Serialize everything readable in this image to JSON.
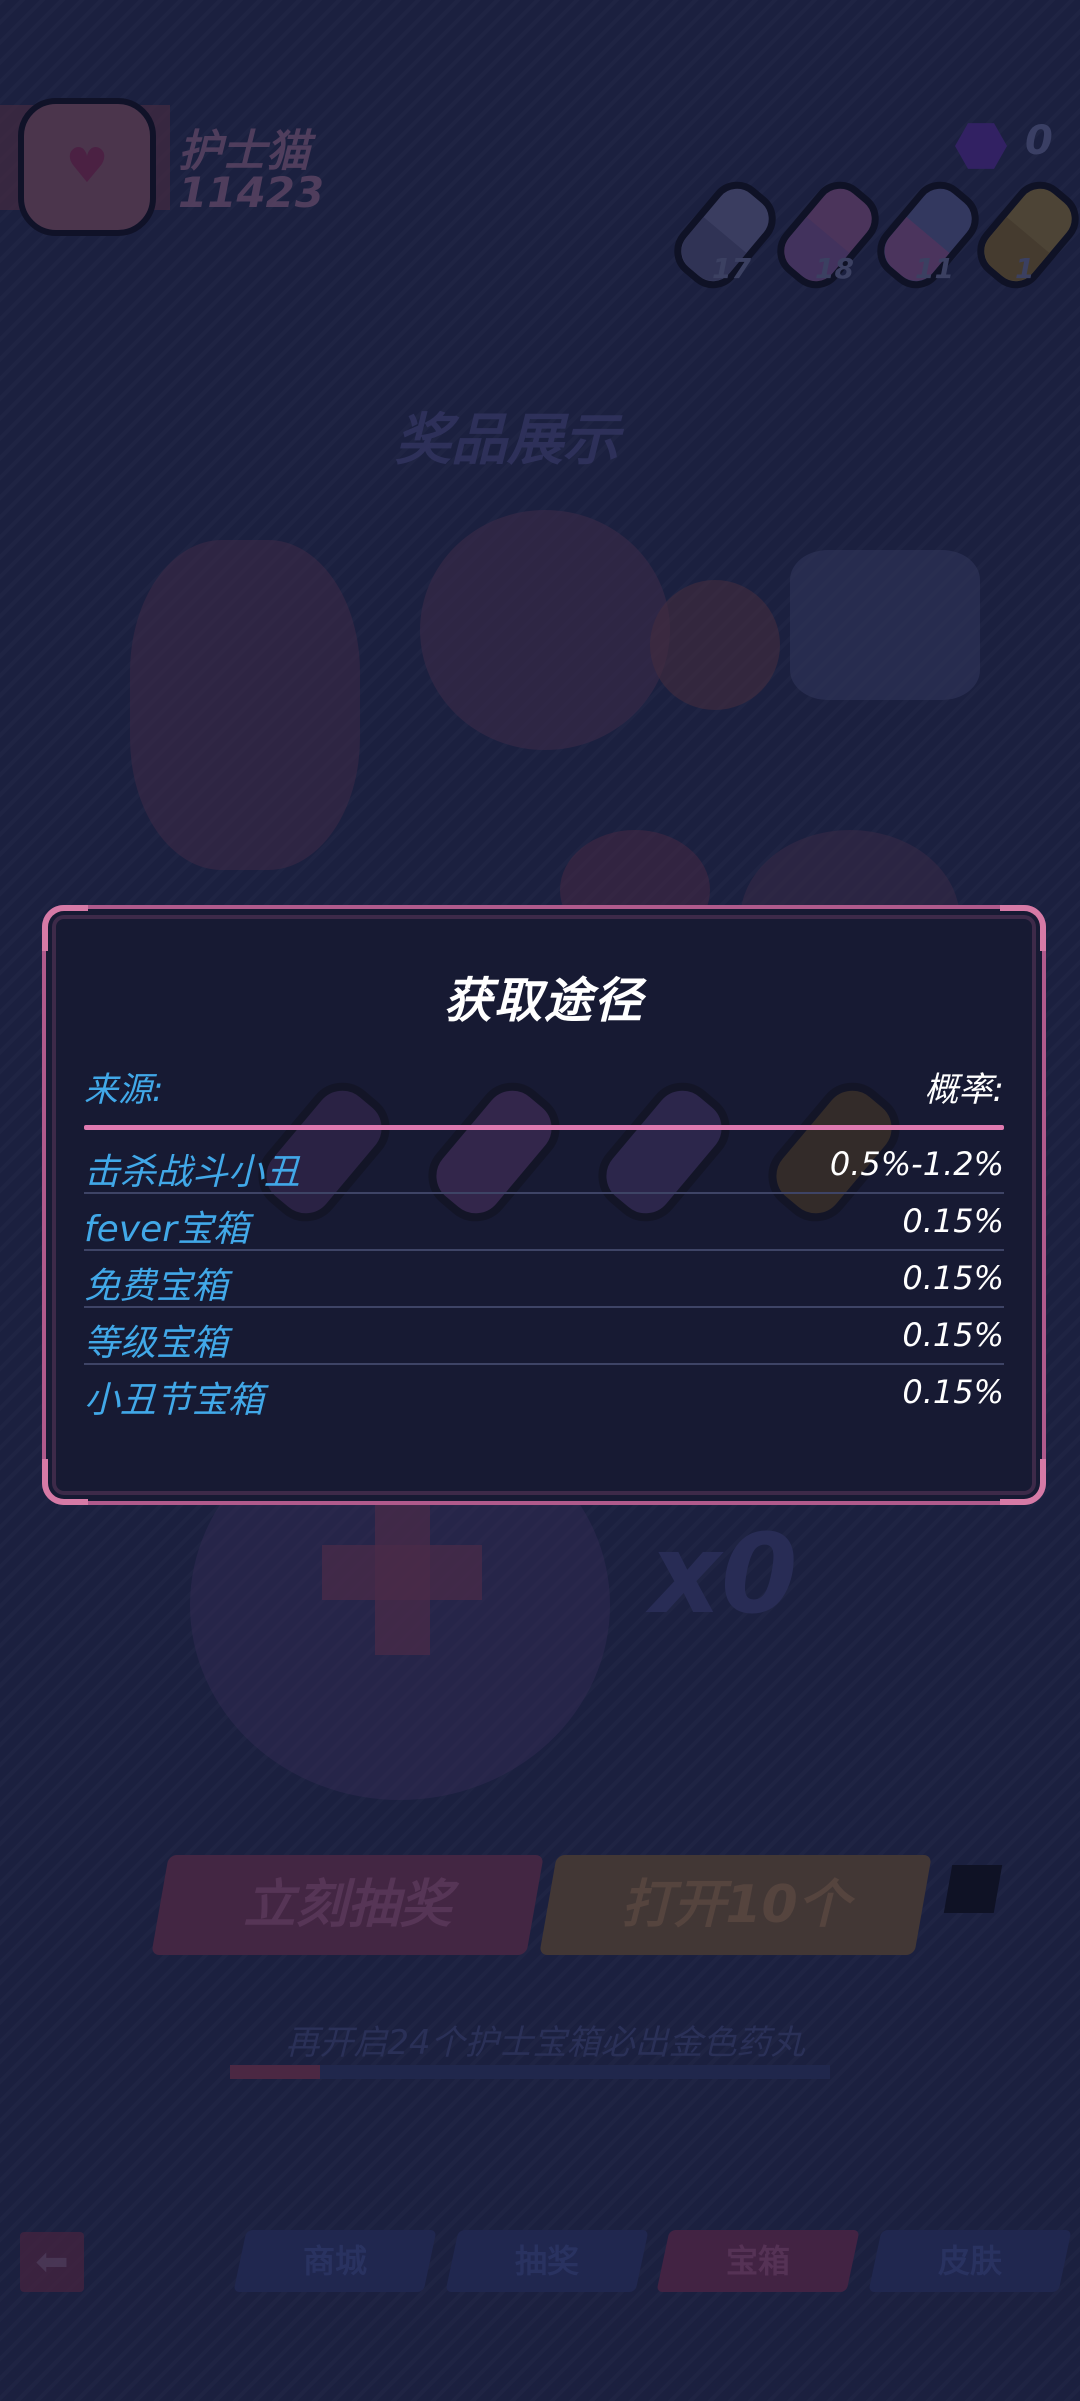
{
  "player": {
    "name": "护士猫",
    "score": "11423"
  },
  "currency": {
    "gems": "0"
  },
  "pills_top": [
    {
      "count": "17",
      "color": "#5c5e86",
      "accent": "#4a4c72"
    },
    {
      "count": "18",
      "color": "#7a4d7c",
      "accent": "#6a4a80"
    },
    {
      "count": "11",
      "color": "#4f5483",
      "accent": "#7a4e80"
    },
    {
      "count": "1",
      "color": "#7e6a3a",
      "accent": "#6f5a2c"
    }
  ],
  "banner": "奖品展示",
  "modal": {
    "title": "获取途径",
    "source_header": "来源:",
    "prob_header": "概率:",
    "rows": [
      {
        "source": "击杀战斗小丑",
        "prob": "0.5%-1.2%"
      },
      {
        "source": "fever宝箱",
        "prob": "0.15%"
      },
      {
        "source": "免费宝箱",
        "prob": "0.15%"
      },
      {
        "source": "等级宝箱",
        "prob": "0.15%"
      },
      {
        "source": "小丑节宝箱",
        "prob": "0.15%"
      }
    ]
  },
  "count_display": "x0",
  "buttons": {
    "draw_now": "立刻抽奖",
    "open_ten": "打开10个"
  },
  "hint": "再开启24个护士宝箱必出金色药丸",
  "progress_fraction": 0.15,
  "nav_tabs": [
    "商城",
    "抽奖",
    "宝箱",
    "皮肤"
  ],
  "colors": {
    "accent_pink": "#e07ab0",
    "accent_blue": "#41a8e8",
    "modal_bg": "#171a33"
  }
}
